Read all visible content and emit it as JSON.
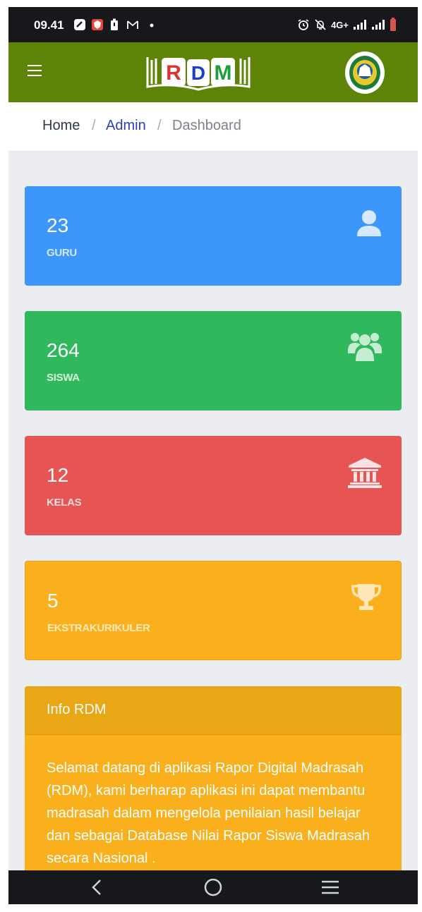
{
  "status_bar": {
    "time": "09.41",
    "network": "4G+",
    "icons": [
      "bible-app-icon",
      "vpn-icon",
      "battery-saver-icon",
      "gmail-icon",
      "dot-icon",
      "alarm-icon",
      "mute-icon",
      "signal-icon",
      "battery-icon"
    ]
  },
  "app_bar": {
    "logo_text": "RDM",
    "menu_icon": "hamburger-icon",
    "emblem": "kemenag-emblem"
  },
  "breadcrumb": {
    "items": [
      "Home",
      "Admin",
      "Dashboard"
    ],
    "separator": "/"
  },
  "stats": [
    {
      "value": "23",
      "label": "GURU",
      "icon": "user-icon",
      "color": "#3d97fb"
    },
    {
      "value": "264",
      "label": "SISWA",
      "icon": "users-icon",
      "color": "#2fb95c"
    },
    {
      "value": "12",
      "label": "KELAS",
      "icon": "institution-icon",
      "color": "#e65454"
    },
    {
      "value": "5",
      "label": "EKSTRAKURIKULER",
      "icon": "trophy-icon",
      "color": "#f9b01c"
    }
  ],
  "info": {
    "title": "Info RDM",
    "body": "Selamat datang di aplikasi Rapor Digital Madrasah (RDM), kami berharap aplikasi ini dapat membantu madrasah dalam mengelola penilaian hasil belajar dan sebagai Database Nilai Rapor Siswa Madrasah secara Nasional ."
  },
  "nav_bar": {
    "buttons": [
      "back-icon",
      "home-icon",
      "recents-icon"
    ]
  }
}
